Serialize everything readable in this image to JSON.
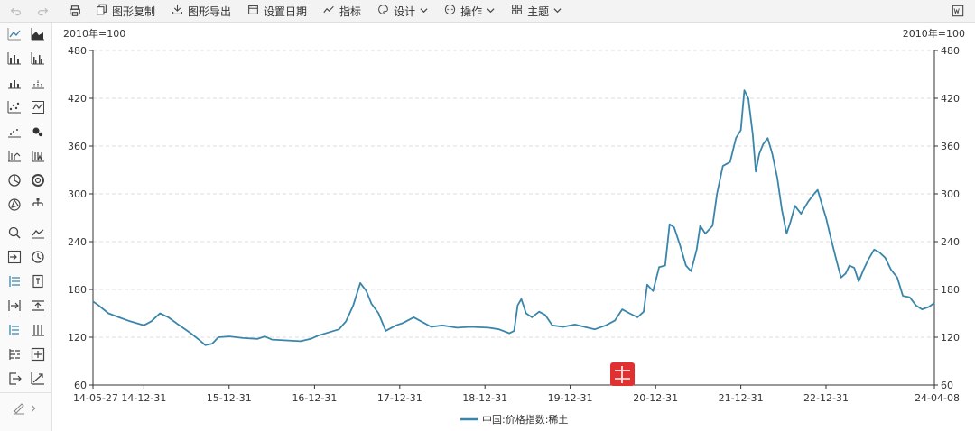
{
  "toolbar": {
    "items": [
      {
        "label": "图形复制",
        "icon": "copy-icon"
      },
      {
        "label": "图形导出",
        "icon": "download-icon"
      },
      {
        "label": "设置日期",
        "icon": "calendar-icon"
      },
      {
        "label": "指标",
        "icon": "line-chart-icon"
      },
      {
        "label": "设计",
        "icon": "palette-icon",
        "dropdown": true
      },
      {
        "label": "操作",
        "icon": "ellipsis-circle-icon",
        "dropdown": true
      },
      {
        "label": "主题",
        "icon": "grid-icon",
        "dropdown": true
      }
    ]
  },
  "colors": {
    "series": "#3a86aa",
    "grid": "#dddddd",
    "axis": "#333333",
    "badge": "#e0302f"
  },
  "chart_data": {
    "type": "line",
    "ylabel_left": "2010年=100",
    "ylabel_right": "2010年=100",
    "ylim": [
      60,
      480
    ],
    "yticks": [
      60,
      120,
      180,
      240,
      300,
      360,
      420,
      480
    ],
    "grid": true,
    "legend_position": "bottom-center",
    "x_range": [
      "2014-05-27",
      "2024-04-08"
    ],
    "xticks": [
      {
        "date": "2014-05-27",
        "label": "14-05-27"
      },
      {
        "date": "2014-12-31",
        "label": "14-12-31"
      },
      {
        "date": "2015-12-31",
        "label": "15-12-31"
      },
      {
        "date": "2016-12-31",
        "label": "16-12-31"
      },
      {
        "date": "2017-12-31",
        "label": "17-12-31"
      },
      {
        "date": "2018-12-31",
        "label": "18-12-31"
      },
      {
        "date": "2019-12-31",
        "label": "19-12-31"
      },
      {
        "date": "2020-12-31",
        "label": "20-12-31"
      },
      {
        "date": "2021-12-31",
        "label": "21-12-31"
      },
      {
        "date": "2022-12-31",
        "label": "22-12-31"
      },
      {
        "date": "2024-04-08",
        "label": "24-04-08"
      }
    ],
    "series": [
      {
        "name": "中国:价格指数:稀土",
        "points": [
          [
            "2014-05-27",
            165
          ],
          [
            "2014-06-20",
            160
          ],
          [
            "2014-08-01",
            150
          ],
          [
            "2014-09-15",
            145
          ],
          [
            "2014-11-01",
            140
          ],
          [
            "2014-12-31",
            135
          ],
          [
            "2015-02-01",
            140
          ],
          [
            "2015-03-10",
            150
          ],
          [
            "2015-04-15",
            145
          ],
          [
            "2015-06-01",
            135
          ],
          [
            "2015-07-20",
            125
          ],
          [
            "2015-09-01",
            115
          ],
          [
            "2015-09-20",
            110
          ],
          [
            "2015-10-20",
            112
          ],
          [
            "2015-11-15",
            120
          ],
          [
            "2016-01-01",
            121
          ],
          [
            "2016-03-01",
            119
          ],
          [
            "2016-05-01",
            118
          ],
          [
            "2016-06-01",
            121
          ],
          [
            "2016-07-01",
            117
          ],
          [
            "2016-09-01",
            116
          ],
          [
            "2016-11-01",
            115
          ],
          [
            "2016-12-15",
            118
          ],
          [
            "2017-01-15",
            122
          ],
          [
            "2017-03-01",
            126
          ],
          [
            "2017-04-15",
            130
          ],
          [
            "2017-05-15",
            140
          ],
          [
            "2017-06-15",
            160
          ],
          [
            "2017-07-15",
            188
          ],
          [
            "2017-08-10",
            178
          ],
          [
            "2017-09-01",
            162
          ],
          [
            "2017-10-01",
            150
          ],
          [
            "2017-11-01",
            128
          ],
          [
            "2017-12-15",
            135
          ],
          [
            "2018-01-15",
            138
          ],
          [
            "2018-03-01",
            145
          ],
          [
            "2018-04-01",
            140
          ],
          [
            "2018-05-15",
            133
          ],
          [
            "2018-07-01",
            135
          ],
          [
            "2018-09-01",
            132
          ],
          [
            "2018-11-01",
            133
          ],
          [
            "2019-01-15",
            132
          ],
          [
            "2019-03-01",
            130
          ],
          [
            "2019-04-15",
            125
          ],
          [
            "2019-05-05",
            128
          ],
          [
            "2019-05-20",
            160
          ],
          [
            "2019-06-05",
            168
          ],
          [
            "2019-06-25",
            150
          ],
          [
            "2019-07-20",
            145
          ],
          [
            "2019-08-20",
            152
          ],
          [
            "2019-09-15",
            148
          ],
          [
            "2019-10-15",
            135
          ],
          [
            "2019-12-01",
            133
          ],
          [
            "2020-01-20",
            136
          ],
          [
            "2020-03-01",
            133
          ],
          [
            "2020-04-15",
            130
          ],
          [
            "2020-06-01",
            135
          ],
          [
            "2020-07-10",
            141
          ],
          [
            "2020-08-10",
            155
          ],
          [
            "2020-09-10",
            150
          ],
          [
            "2020-10-15",
            145
          ],
          [
            "2020-11-10",
            152
          ],
          [
            "2020-11-25",
            186
          ],
          [
            "2020-12-20",
            178
          ],
          [
            "2021-01-15",
            208
          ],
          [
            "2021-02-10",
            210
          ],
          [
            "2021-03-01",
            262
          ],
          [
            "2021-03-20",
            258
          ],
          [
            "2021-04-15",
            235
          ],
          [
            "2021-05-10",
            210
          ],
          [
            "2021-06-01",
            203
          ],
          [
            "2021-06-25",
            230
          ],
          [
            "2021-07-10",
            260
          ],
          [
            "2021-08-01",
            250
          ],
          [
            "2021-09-01",
            260
          ],
          [
            "2021-09-20",
            300
          ],
          [
            "2021-10-15",
            335
          ],
          [
            "2021-11-15",
            340
          ],
          [
            "2021-12-10",
            370
          ],
          [
            "2021-12-31",
            380
          ],
          [
            "2022-01-15",
            430
          ],
          [
            "2022-02-01",
            420
          ],
          [
            "2022-02-20",
            375
          ],
          [
            "2022-03-05",
            328
          ],
          [
            "2022-03-20",
            350
          ],
          [
            "2022-04-05",
            362
          ],
          [
            "2022-04-25",
            370
          ],
          [
            "2022-05-15",
            350
          ],
          [
            "2022-06-05",
            320
          ],
          [
            "2022-06-25",
            280
          ],
          [
            "2022-07-15",
            250
          ],
          [
            "2022-08-01",
            265
          ],
          [
            "2022-08-20",
            285
          ],
          [
            "2022-09-15",
            275
          ],
          [
            "2022-10-15",
            290
          ],
          [
            "2022-11-10",
            300
          ],
          [
            "2022-11-25",
            305
          ],
          [
            "2022-12-15",
            285
          ],
          [
            "2022-12-31",
            270
          ],
          [
            "2023-01-20",
            245
          ],
          [
            "2023-02-15",
            215
          ],
          [
            "2023-03-05",
            195
          ],
          [
            "2023-03-25",
            200
          ],
          [
            "2023-04-10",
            210
          ],
          [
            "2023-05-01",
            207
          ],
          [
            "2023-05-20",
            190
          ],
          [
            "2023-06-10",
            205
          ],
          [
            "2023-07-01",
            218
          ],
          [
            "2023-07-25",
            230
          ],
          [
            "2023-08-15",
            227
          ],
          [
            "2023-09-10",
            220
          ],
          [
            "2023-10-05",
            205
          ],
          [
            "2023-11-01",
            195
          ],
          [
            "2023-11-25",
            172
          ],
          [
            "2023-12-25",
            170
          ],
          [
            "2024-01-20",
            160
          ],
          [
            "2024-02-15",
            155
          ],
          [
            "2024-03-15",
            158
          ],
          [
            "2024-04-08",
            163
          ]
        ]
      }
    ]
  }
}
